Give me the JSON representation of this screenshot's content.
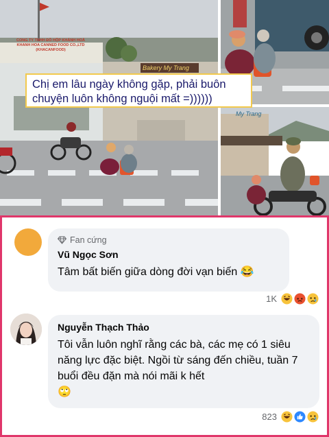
{
  "post": {
    "caption": "Chị em lâu ngày không gặp, phải buôn chuyện luôn không nguội mất =))))))",
    "signs": {
      "company": "CONG TY TNHH ĐỒ HỘP KHÁNH HOÀ",
      "company_sub": "KHANH HOA CANNED FOOD CO.,LTD (KHACANFOOD)",
      "bakery": "Bakery My Trang",
      "bakery_small": "My Trang"
    }
  },
  "comments": [
    {
      "badge": "Fan cứng",
      "name": "Vũ Ngọc Sơn",
      "text": "Tâm bất biến giữa dòng đời vạn biến",
      "text_emoji": "😂",
      "reaction_count": "1K"
    },
    {
      "badge": "",
      "name": "Nguyễn Thạch Thảo",
      "text": "Tôi vẫn luôn nghĩ rằng các bà, các mẹ có 1 siêu năng lực đặc biệt. Ngồi từ sáng đến chiều, tuần 7 buổi đều đặn mà nói mãi k hết",
      "text_emoji": "🙄",
      "reaction_count": "823"
    }
  ],
  "colors": {
    "panel_border": "#e0366a",
    "bubble_bg": "#f0f2f5",
    "caption_border": "#f2c94c",
    "avatar_1": "#f2a93b"
  }
}
